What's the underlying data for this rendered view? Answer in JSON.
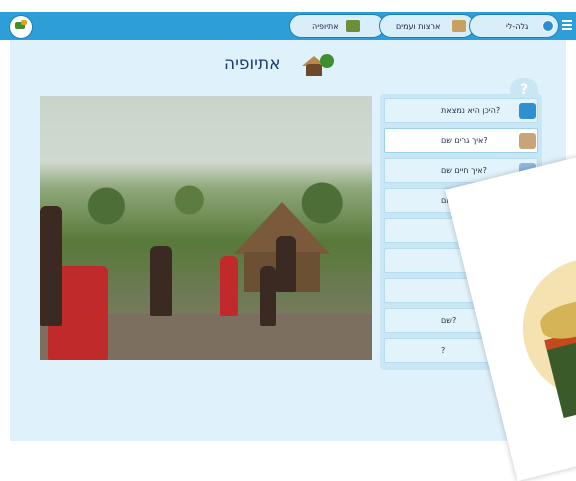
{
  "header": {
    "tabs": [
      {
        "label": "גלה-לי",
        "icon": "search-icon"
      },
      {
        "label": "ארצות ועמים",
        "icon": "pyramids-icon"
      },
      {
        "label": "אתיופיה",
        "icon": "village-icon"
      }
    ],
    "menu_icon": "menu-icon",
    "logo_icon": "logo-icon"
  },
  "page": {
    "title": "אתיופיה"
  },
  "help": {
    "label": "?"
  },
  "questions": [
    {
      "label": "היכן היא נמצאת?",
      "icon": "globe-icon",
      "active": false
    },
    {
      "label": "איך גרים שם?",
      "icon": "house-icon",
      "active": true
    },
    {
      "label": "איך חיים שם?",
      "icon": "computer-icon",
      "active": false
    },
    {
      "label": "מה המקום?",
      "icon": "",
      "active": false
    },
    {
      "label": "",
      "icon": "",
      "active": false
    },
    {
      "label": "",
      "icon": "",
      "active": false
    },
    {
      "label": "",
      "icon": "",
      "active": false
    },
    {
      "label": "שם?",
      "icon": "",
      "active": false
    },
    {
      "label": "?",
      "icon": "",
      "active": false
    }
  ],
  "colors": {
    "header_bg": "#2e9ed9",
    "main_bg": "#dff1fa",
    "panel_bg": "#c9e6f5",
    "title_color": "#1a3f6b"
  }
}
